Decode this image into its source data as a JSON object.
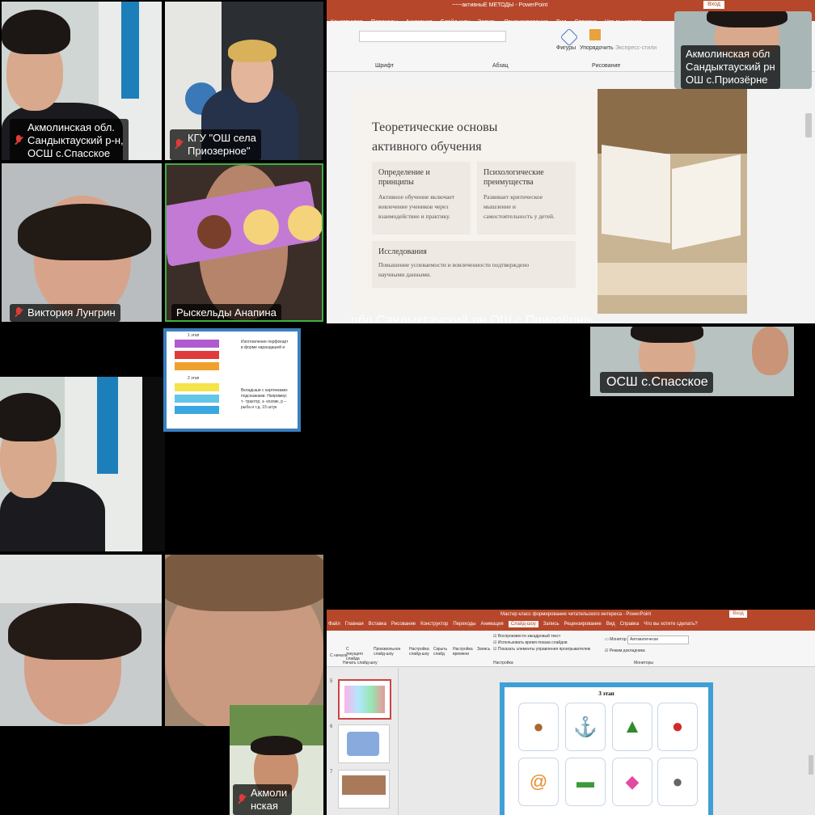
{
  "participants": {
    "p1": "Акмолинская обл.\nСандыктауский р-н,\nОСШ с.Спасское",
    "p2": "КГУ \"ОШ села\nПриозерное\"",
    "p3": "Виктория Лунгрин",
    "p4": "Рыскельды Анапина",
    "p5": "Акмоли\nнская",
    "share_overlay": "Акмолинская обл\nСандыктауский рн\nОШ с.Приозёрне",
    "share2_overlay": "ОСШ с.Спасское"
  },
  "share1": {
    "title": "~~~активныЕ МЕТОДЫ - PowerPoint",
    "login": "Вход",
    "tabs": [
      "Конструктор",
      "Переходы",
      "Анимация",
      "Слайд-шоу",
      "Запись",
      "Рецензирование",
      "Вид",
      "Справка",
      "Что вы хотите"
    ],
    "groups": [
      "Шрифт",
      "Абзац",
      "Рисование"
    ],
    "tools": [
      "Фигуры",
      "Упорядочить",
      "Экспресс-стили"
    ],
    "slide": {
      "heading": "Теоретические основы\nактивного обучения",
      "c1_title": "Определение и\nпринципы",
      "c1_text": "Активное обучение включает\nвовлечение учеников через\nвзаимодействие и практику.",
      "c2_title": "Психологические\nпреимущества",
      "c2_text": "Развивает критическое\nмышление и\nсамостоятельность у детей.",
      "c3_title": "Исследования",
      "c3_text": "Повышение успеваемости и вовлеченности подтверждено\nнаучными данными."
    },
    "bottom_watermark": "обл Сандыктауский рн ОШ с Приозёрне"
  },
  "worksheet": {
    "label": "1 этап",
    "text1": "Изготовление перфокарт в форме карандашей и",
    "label2": "2 этап",
    "text2": "Вкладыши с картинками-подсказками. Например: т- трактор, з- козлик, р – рыба и т.д. 15 штук"
  },
  "share3": {
    "title": "Мастер класс формирование читательского интереса - PowerPoint",
    "login": "Вход",
    "tabs": [
      "Файл",
      "Главная",
      "Вставка",
      "Рисование",
      "Конструктор",
      "Переходы",
      "Анимация",
      "Слайд-шоу",
      "Запись",
      "Рецензирование",
      "Вид",
      "Справка",
      "Что вы хотите сделать?"
    ],
    "active_tab": "Слайд-шоу",
    "buttons": [
      "С начала",
      "С текущего слайда",
      "Произвольное слайд-шоу",
      "Настройка слайд-шоу",
      "Скрыть слайд",
      "Настройка времени",
      "Запись"
    ],
    "group_start": "Начать слайд-шоу",
    "group_setup": "Настройка",
    "group_monitors": "Мониторы",
    "checks": [
      "Воспроизвести закадровый текст",
      "Использовать время показа слайдов",
      "Показать элементы управления проигрывателем"
    ],
    "monitor_label": "Монитор:",
    "monitor_value": "Автоматически",
    "presenter_view": "Режим докладчика",
    "slide_numbers": [
      "5",
      "6",
      "7"
    ],
    "slide_heading": "3 этап"
  },
  "colors": {
    "ppt_red": "#b7472a",
    "tile_border_active": "#3cb043"
  }
}
